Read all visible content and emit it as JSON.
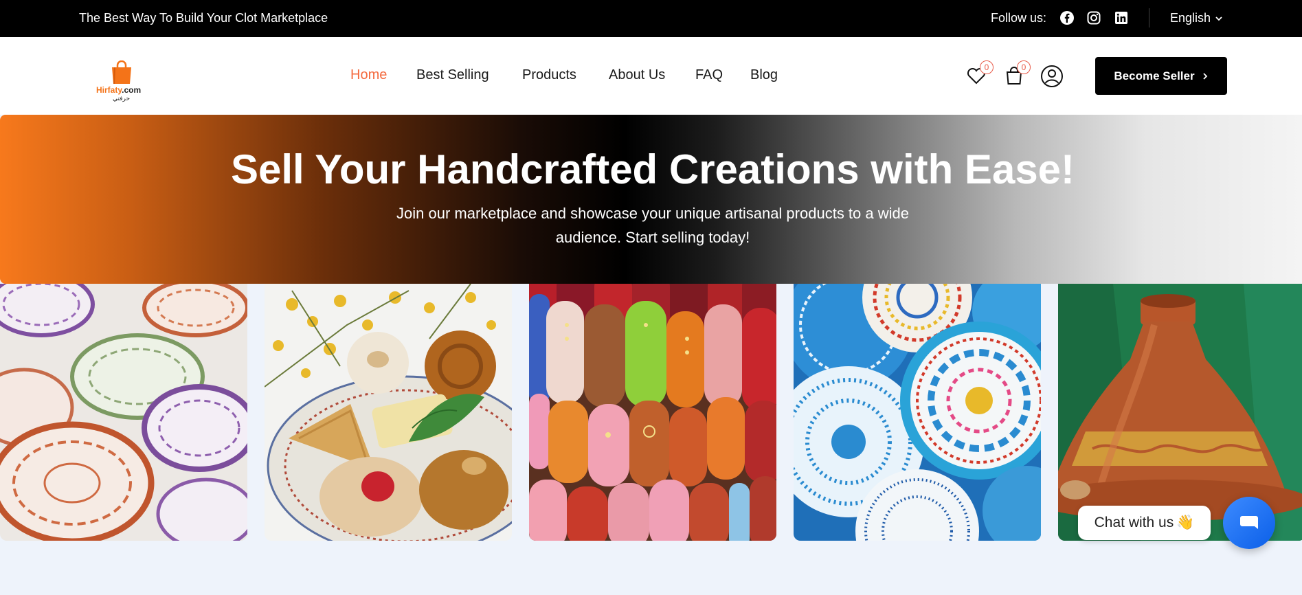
{
  "topbar": {
    "tagline": "The Best Way To Build Your Clot Marketplace",
    "follow_label": "Follow us:",
    "social": [
      "facebook-icon",
      "instagram-icon",
      "linkedin-icon"
    ],
    "language": "English"
  },
  "header": {
    "logo": {
      "brand_main": "Hirfaty",
      "brand_suffix": ".com",
      "arabic": "حرفتي"
    },
    "nav": [
      {
        "label": "Home",
        "active": true
      },
      {
        "label": "Best Selling",
        "active": false
      },
      {
        "label": "Products",
        "active": false
      },
      {
        "label": "About Us",
        "active": false
      },
      {
        "label": "FAQ",
        "active": false
      },
      {
        "label": "Blog",
        "active": false
      }
    ],
    "wishlist_count": "0",
    "cart_count": "0",
    "cta_label": "Become Seller",
    "accent_color": "#f46a3e"
  },
  "hero": {
    "title": "Sell Your Handcrafted Creations with Ease!",
    "subtitle": "Join our marketplace and showcase your unique artisanal products to a wide audience. Start selling today!",
    "gradient_colors": [
      "#f7791c",
      "#000000",
      "#f4f4f4"
    ]
  },
  "gallery": [
    {
      "name": "ceramic-bowls-image"
    },
    {
      "name": "moroccan-pastries-image"
    },
    {
      "name": "leather-slippers-image"
    },
    {
      "name": "blue-plates-image"
    },
    {
      "name": "tagine-pot-image"
    }
  ],
  "chat": {
    "label": "Chat with us",
    "emoji": "👋",
    "fab_color": "#1a6ff5"
  }
}
